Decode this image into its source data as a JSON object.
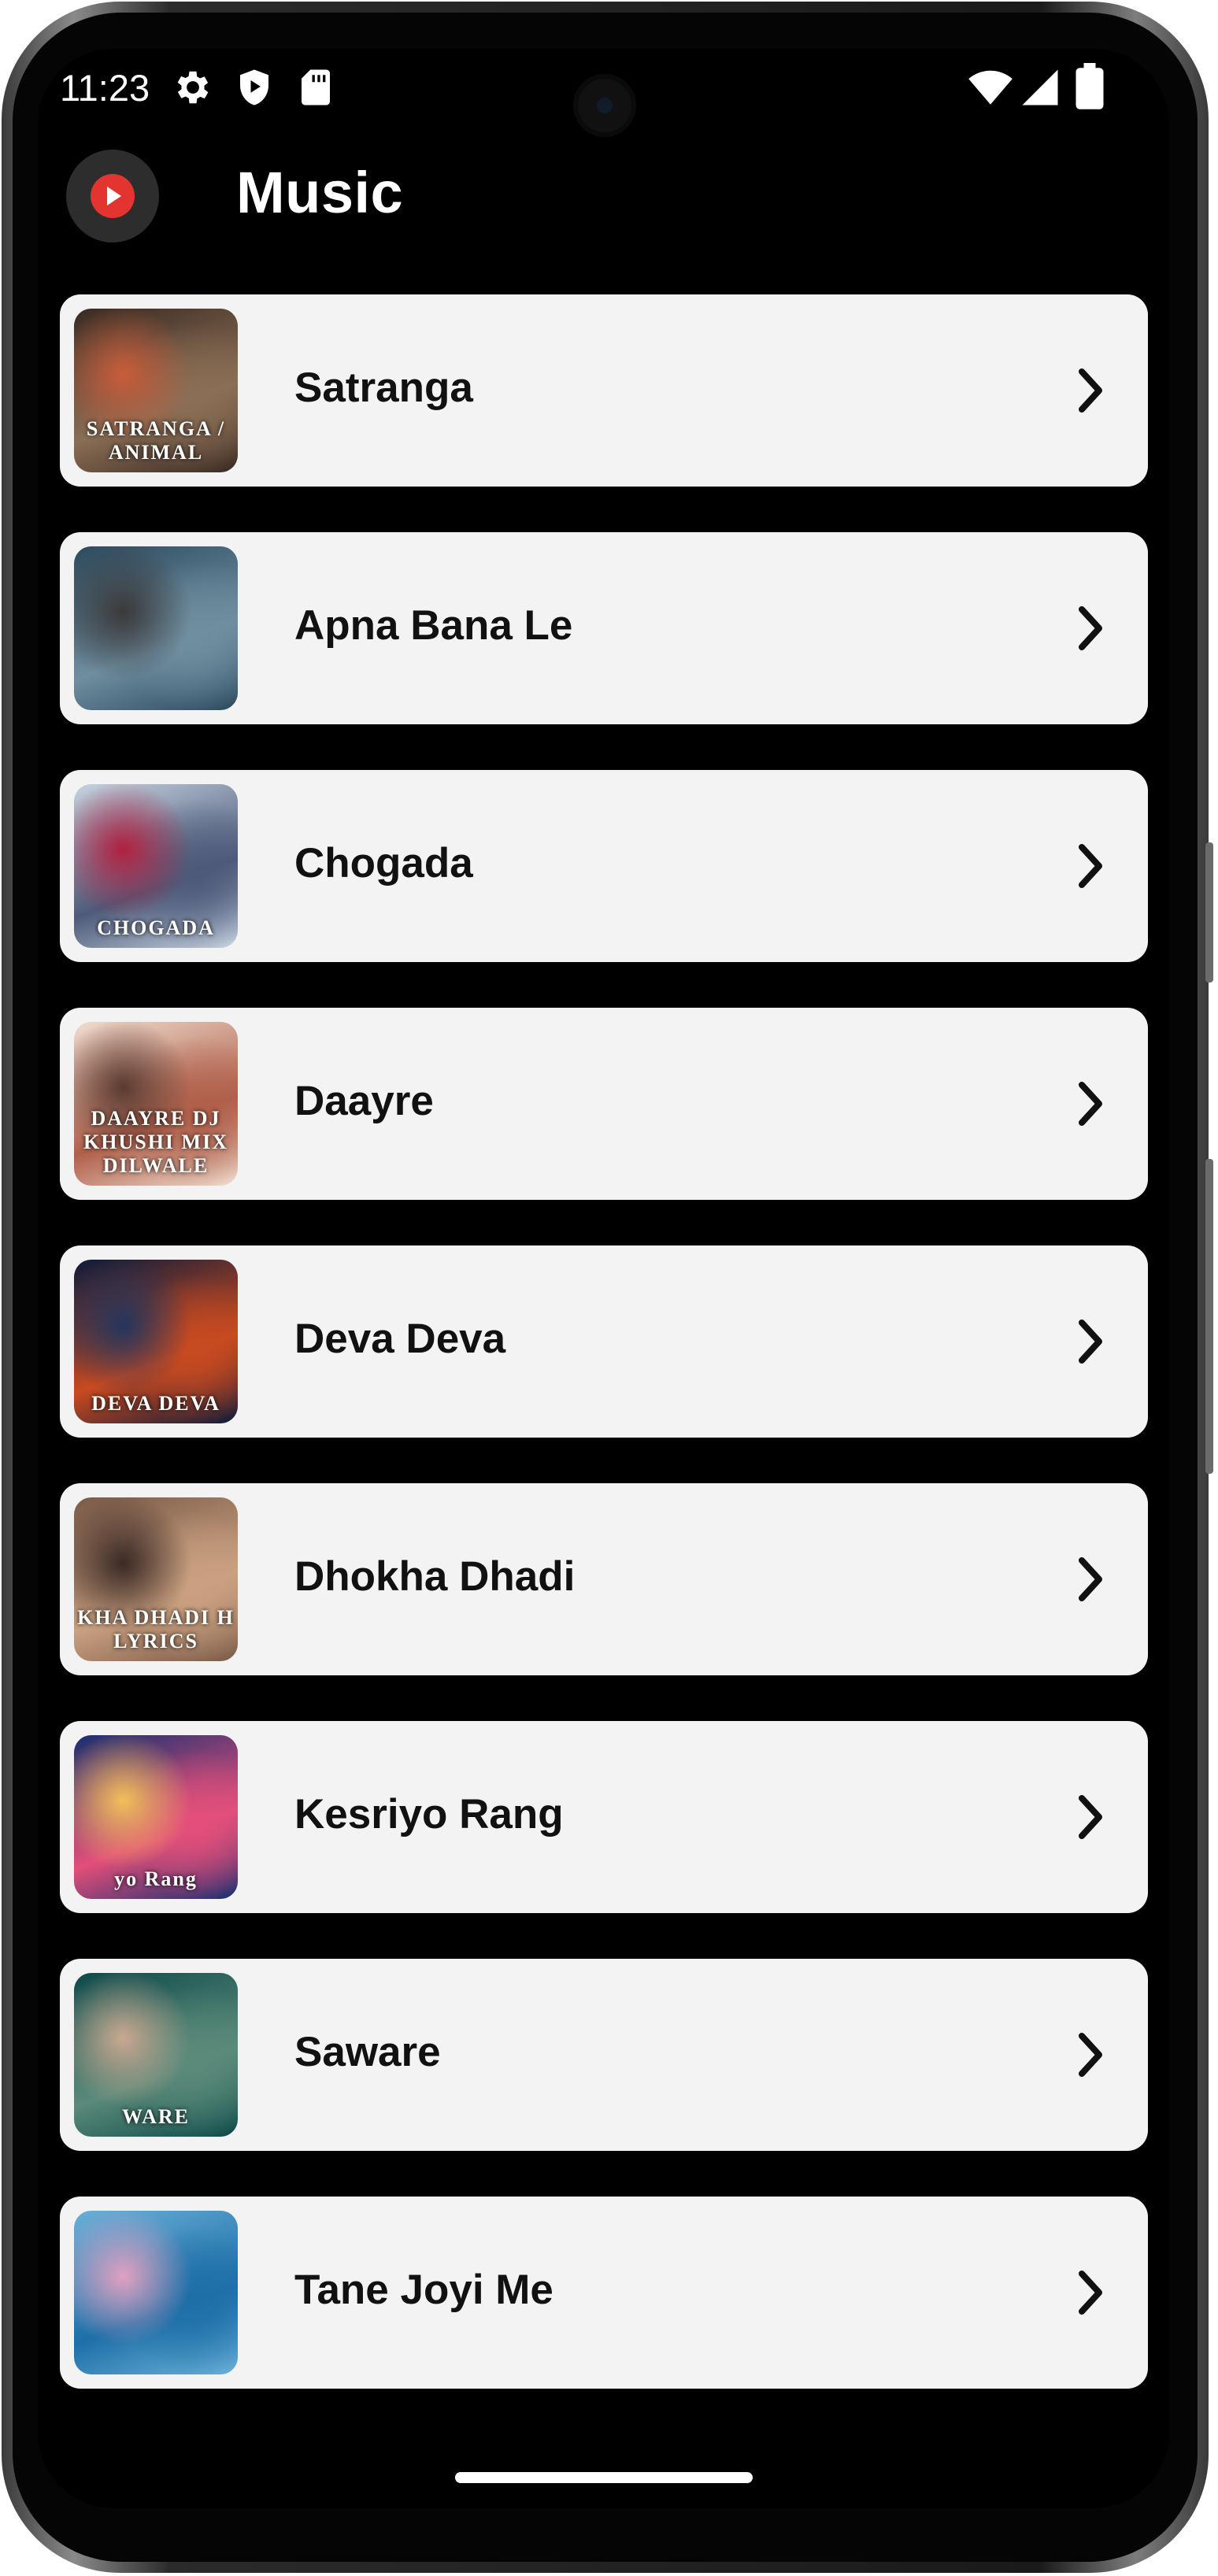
{
  "status_bar": {
    "time": "11:23",
    "left_icons": [
      "gear-icon",
      "shield-play-icon",
      "sd-card-icon"
    ],
    "right_icons": [
      "wifi-icon",
      "cellular-signal-icon",
      "battery-icon"
    ]
  },
  "app_bar": {
    "title": "Music",
    "logo": "play-logo-icon"
  },
  "songs": [
    {
      "title": "Satranga",
      "thumb_text": "SATRANGA / ANIMAL",
      "thumb_colors": [
        "#3a2a22",
        "#8a6e55",
        "#c95c3a"
      ]
    },
    {
      "title": "Apna Bana Le",
      "thumb_text": "",
      "thumb_colors": [
        "#2d4a5e",
        "#6f8ea0",
        "#3b3a3a"
      ]
    },
    {
      "title": "Chogada",
      "thumb_text": "CHOGADA",
      "thumb_colors": [
        "#c7d3e0",
        "#4d5a7a",
        "#b02040"
      ]
    },
    {
      "title": "Daayre",
      "thumb_text": "DAAYRE DJ KHUSHI MIX DILWALE",
      "thumb_colors": [
        "#f0ddd0",
        "#b0604a",
        "#5a3a30"
      ]
    },
    {
      "title": "Deva Deva",
      "thumb_text": "DEVA DEVA",
      "thumb_colors": [
        "#0d1b3a",
        "#c84a20",
        "#24365e"
      ]
    },
    {
      "title": "Dhokha Dhadi",
      "thumb_text": "KHA DHADI H LYRICS",
      "thumb_colors": [
        "#7a5a48",
        "#caa080",
        "#3a2a25"
      ]
    },
    {
      "title": "Kesriyo Rang",
      "thumb_text": "yo Rang",
      "thumb_colors": [
        "#1a2f70",
        "#e34f7a",
        "#f2c05a"
      ]
    },
    {
      "title": "Saware",
      "thumb_text": "WARE",
      "thumb_colors": [
        "#0e4a4a",
        "#5a8a7a",
        "#caa890"
      ]
    },
    {
      "title": "Tane Joyi Me",
      "thumb_text": "",
      "thumb_colors": [
        "#6ab0d8",
        "#1e6fa8",
        "#e0a0c0"
      ]
    }
  ],
  "chevron": "chevron-right-icon"
}
